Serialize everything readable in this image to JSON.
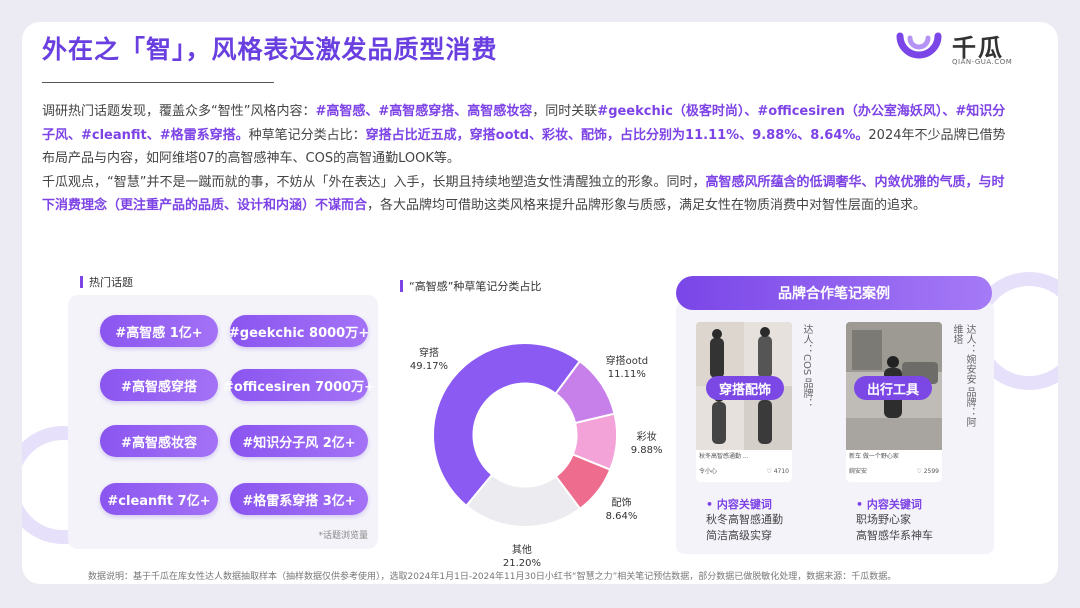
{
  "header": {
    "title": "外在之「智」，风格表达激发品质型消费",
    "logo_cn": "千瓜",
    "logo_en": "QIAN-GUA.COM"
  },
  "paragraphs": {
    "p1": [
      {
        "t": "调研热门话题发现，覆盖众多“智性”风格内容：",
        "h": false
      },
      {
        "t": "#高智感、#高智感穿搭、高智感妆容",
        "h": true
      },
      {
        "t": "，同时关联",
        "h": false
      },
      {
        "t": "#geekchic（极客时尚）、#officesiren（办公室海妖风）、#知识分子风、#cleanfit、#格雷系穿搭。",
        "h": true
      },
      {
        "t": "种草笔记分类占比：",
        "h": false
      },
      {
        "t": "穿搭占比近五成，穿搭ootd、彩妆、配饰，占比分别为11.11%、9.88%、8.64%。",
        "h": true
      },
      {
        "t": "2024年不少品牌已借势布局产品与内容，如阿维塔07的高智感神车、COS的高智通勤LOOK等。",
        "h": false
      }
    ],
    "p2": [
      {
        "t": "千瓜观点，“智慧”并不是一蹴而就的事，不妨从「外在表达」入手，长期且持续地塑造女性清醒独立的形象。同时，",
        "h": false
      },
      {
        "t": "高智感风所蕴含的低调奢华、内敛优雅的气质，与时下消费理念（更注重产品的品质、设计和内涵）不谋而合",
        "h": true
      },
      {
        "t": "，各大品牌均可借助这类风格来提升品牌形象与质感，满足女性在物质消费中对智性层面的追求。",
        "h": false
      }
    ]
  },
  "hot_topics": {
    "label": "热门话题",
    "note": "*话题浏览量",
    "pills": [
      "#高智感 1亿+",
      "#geekchic  8000万+",
      "#高智感穿搭",
      "#officesiren 7000万+",
      "#高智感妆容",
      "#知识分子风  2亿+",
      "#cleanfit 7亿+",
      "#格雷系穿搭 3亿+"
    ]
  },
  "donut": {
    "label": "“高智感”种草笔记分类占比"
  },
  "chart_data": {
    "type": "pie",
    "title": "“高智感”种草笔记分类占比",
    "categories": [
      "穿搭",
      "穿搭ootd",
      "彩妆",
      "配饰",
      "其他"
    ],
    "values": [
      49.17,
      11.11,
      9.88,
      8.64,
      21.2
    ],
    "value_labels": [
      "49.17%",
      "11.11%",
      "9.88%",
      "8.64%",
      "21.20%"
    ],
    "colors": [
      "#8a5af2",
      "#c77fe9",
      "#f4a3d9",
      "#ee6d8f",
      "#ececf0"
    ],
    "inner_radius_ratio": 0.56
  },
  "cases": {
    "header": "品牌合作笔记案例",
    "left": {
      "tag": "穿搭配饰",
      "side": "达人：COS 品牌：",
      "foot_text": "秋冬高智感通勤 ...",
      "foot_user": "令小心",
      "foot_likes": "4710",
      "kw_title": "• 内容关键词",
      "kw": [
        "秋冬高智感通勤",
        "简洁高级实穿"
      ]
    },
    "right": {
      "tag": "出行工具",
      "side": "达人：婉安安 品牌：阿维塔",
      "foot_text": "新车 做一个野心家",
      "foot_user": "婉安安",
      "foot_likes": "2599",
      "kw_title": "• 内容关键词",
      "kw": [
        "职场野心家",
        "高智感华系神车"
      ]
    }
  },
  "footer": "数据说明：基于千瓜在库女性达人数据抽取样本（抽样数据仅供参考使用），选取2024年1月1日-2024年11月30日小红书“智慧之力”相关笔记预估数据，部分数据已做脱敏化处理，数据来源：千瓜数据。"
}
